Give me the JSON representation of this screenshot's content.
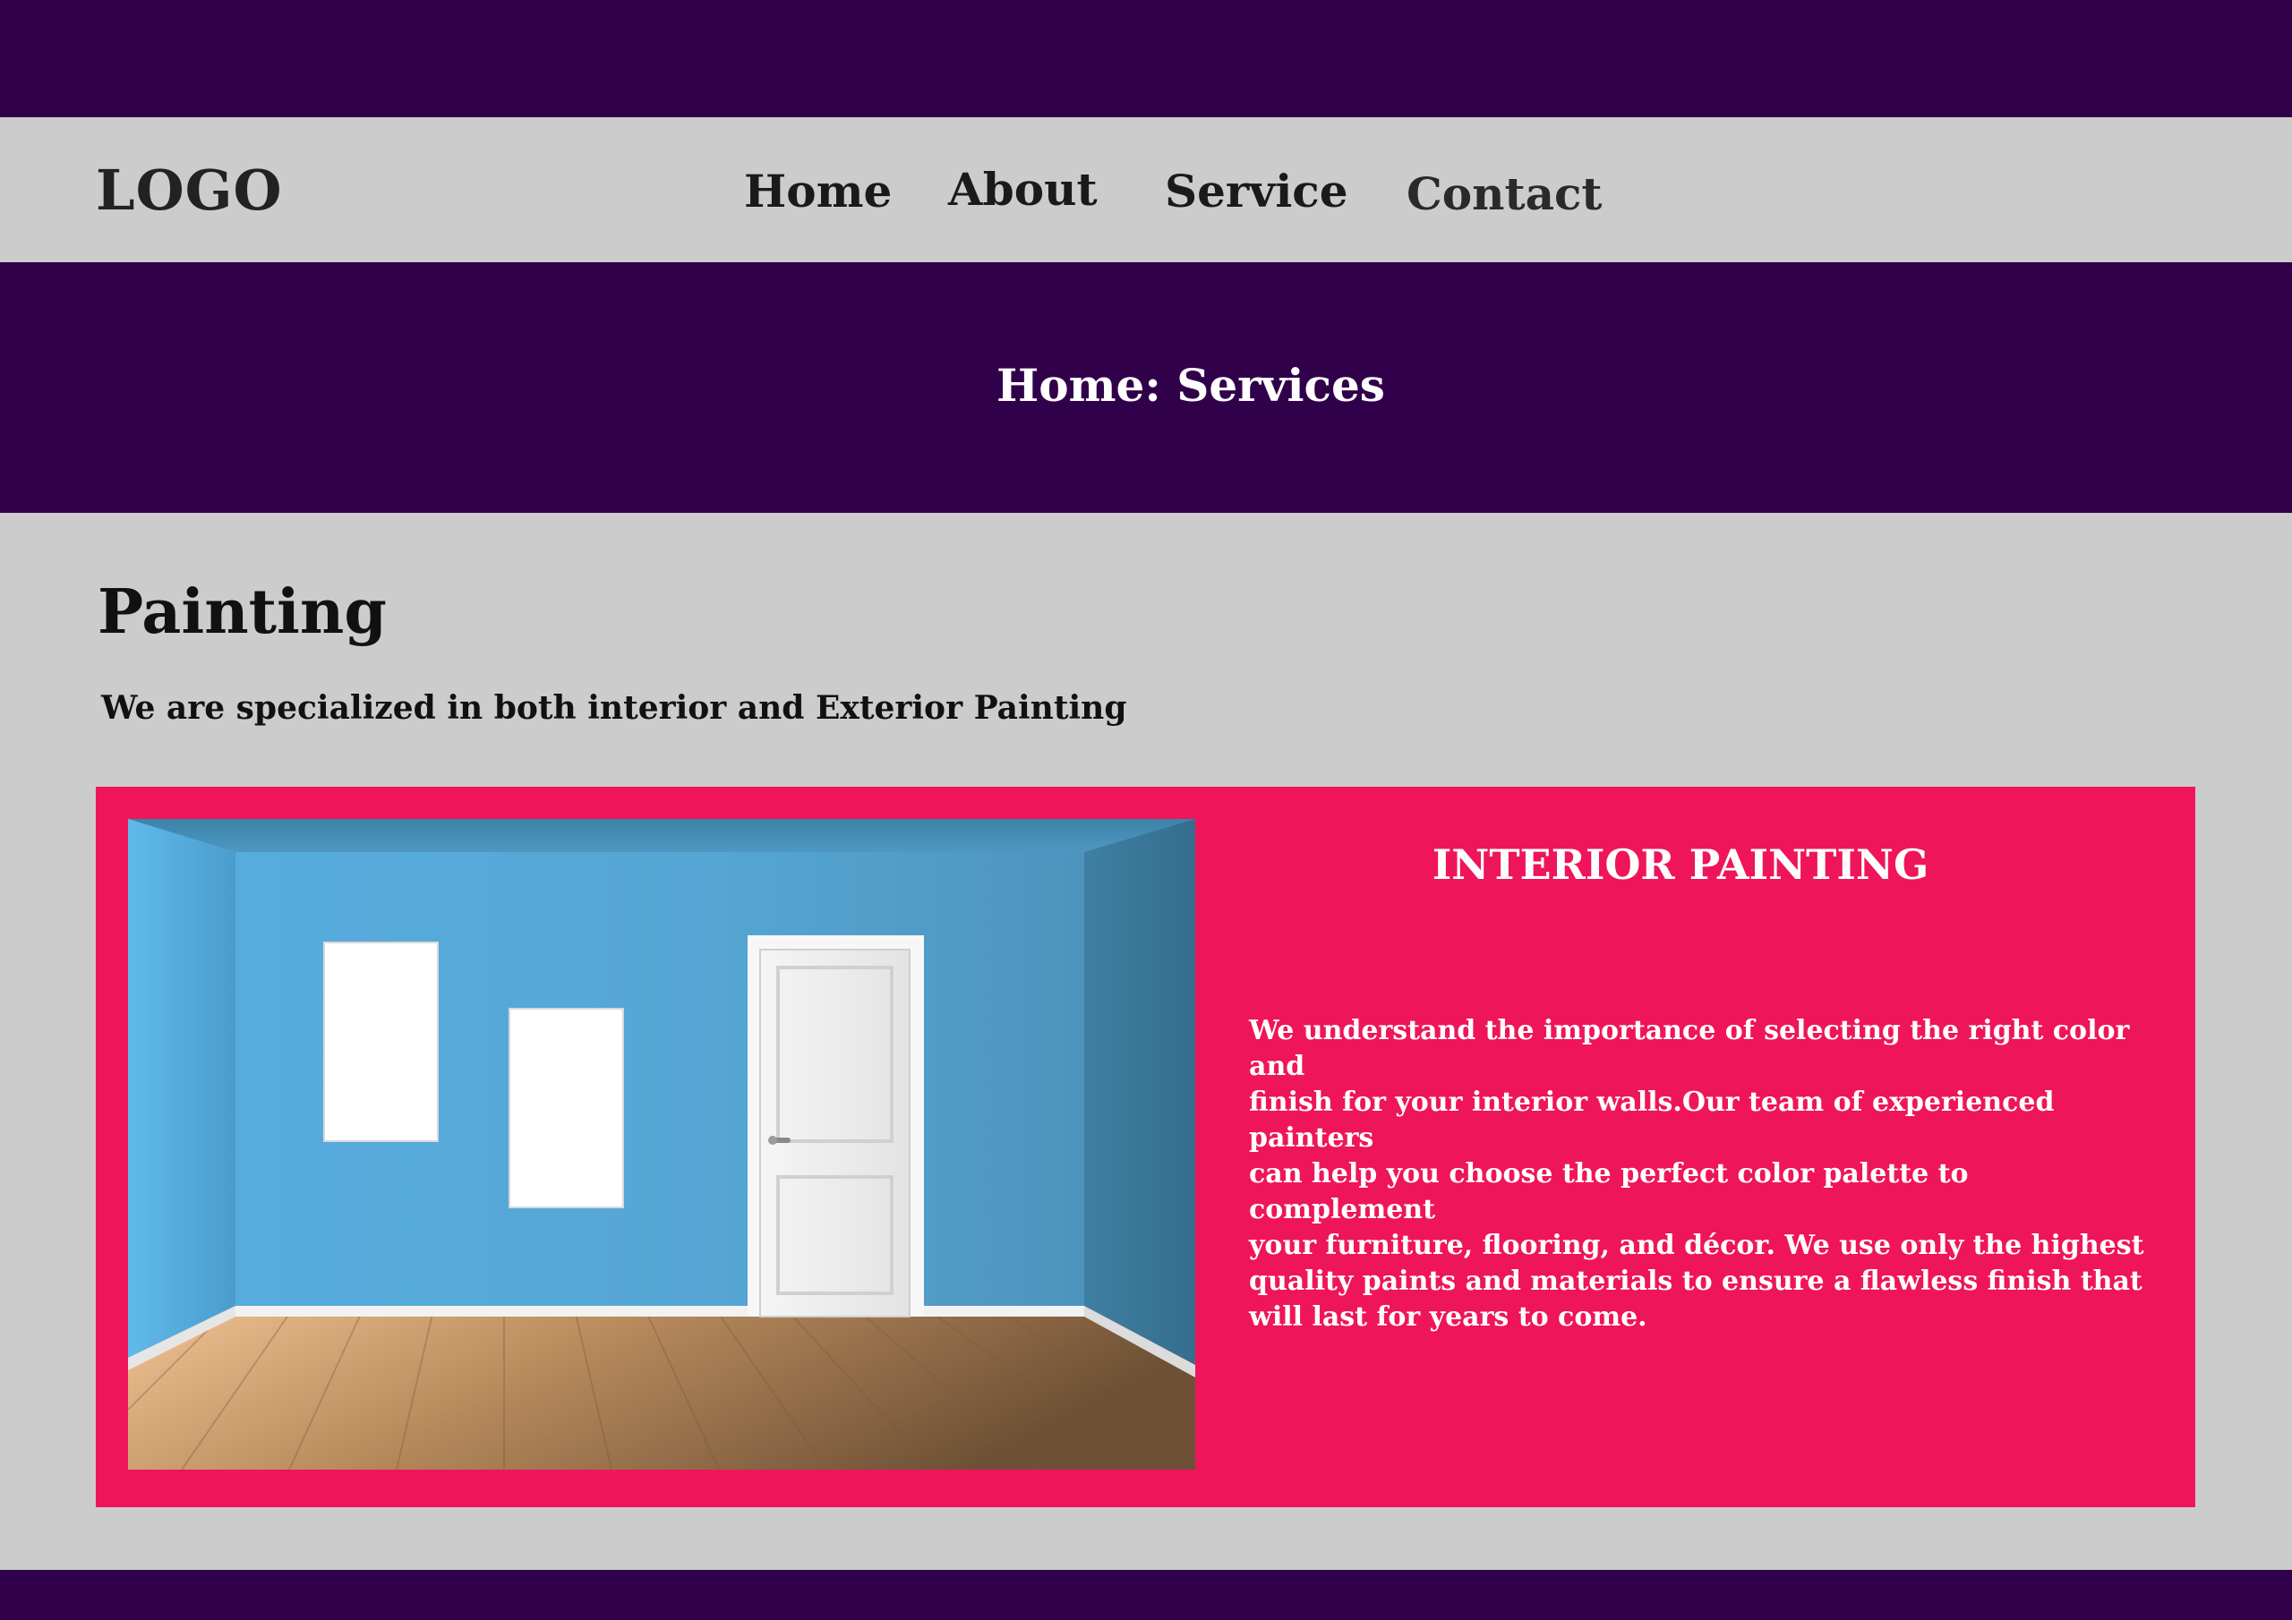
{
  "nav": {
    "logo": "LOGO",
    "links": [
      "Home",
      "About",
      "Service",
      "Contact"
    ]
  },
  "hero": {
    "title": "Home: Services"
  },
  "section": {
    "title": "Painting",
    "subtitle": "We are specialized in both interior and Exterior Painting"
  },
  "card": {
    "heading": "INTERIOR PAINTING",
    "text": "We understand the importance of selecting the right color and\n finish for your interior walls.Our team of experienced painters\ncan help you choose the perfect color palette to complement\n your furniture, flooring, and décor. We use only the highest\n quality paints and materials to ensure a flawless finish that\nwill last for years to come.",
    "image": "room-interior-image"
  },
  "colors": {
    "dark_purple": "#31004a",
    "light_gray": "#cccccc",
    "pink": "#ef155b",
    "wall_blue": "#52a6d2",
    "floor_wood": "#a87d52"
  }
}
